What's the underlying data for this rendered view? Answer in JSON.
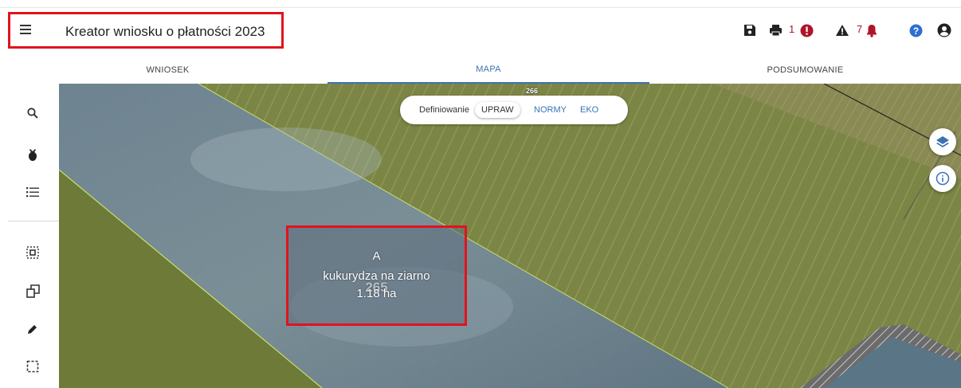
{
  "header": {
    "title": "Kreator wniosku o płatności 2023",
    "print_count": "1",
    "warning_count": "7"
  },
  "tabs": [
    {
      "label": "WNIOSEK"
    },
    {
      "label": "MAPA"
    },
    {
      "label": "PODSUMOWANIE"
    }
  ],
  "map": {
    "define_label": "Definiowanie",
    "options": [
      {
        "label": "UPRAW",
        "selected": true
      },
      {
        "label": "NORMY"
      },
      {
        "label": "EKO"
      }
    ],
    "parcel_top_number": "266",
    "parcel_number": "265",
    "crop_label": {
      "code": "A",
      "name": "kukurydza na ziarno",
      "area": "1.18 ha"
    }
  },
  "colors": {
    "accent": "#3a72b5",
    "highlight": "#e0141e",
    "error": "#b0142a"
  }
}
